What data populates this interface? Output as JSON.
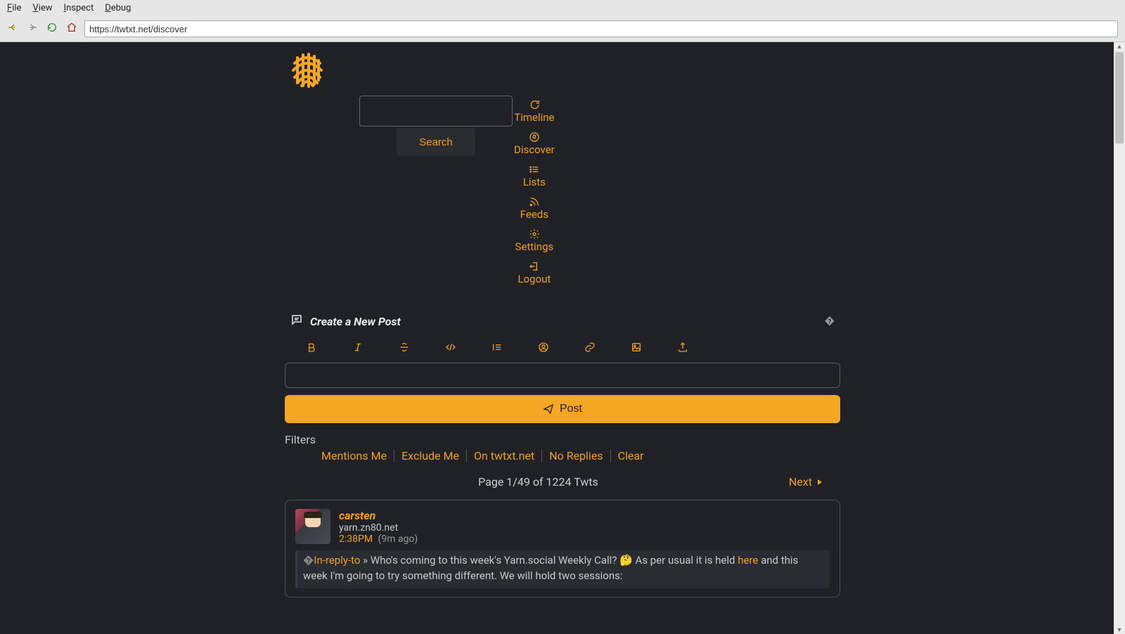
{
  "browser": {
    "menus": {
      "file": "File",
      "view": "View",
      "inspect": "Inspect",
      "debug": "Debug"
    },
    "url": "https://twtxt.net/discover"
  },
  "nav": {
    "search_label": "Search",
    "items": [
      {
        "label": "Timeline"
      },
      {
        "label": "Discover"
      },
      {
        "label": "Lists"
      },
      {
        "label": "Feeds"
      },
      {
        "label": "Settings"
      },
      {
        "label": "Logout"
      }
    ]
  },
  "compose": {
    "title": "Create a New Post",
    "post_label": "Post",
    "help": "�"
  },
  "filters": {
    "label": "Filters",
    "items": [
      "Mentions Me",
      "Exclude Me",
      "On twtxt.net",
      "No Replies",
      "Clear"
    ]
  },
  "pager": {
    "info": "Page 1/49 of 1224 Twts",
    "next": "Next"
  },
  "post": {
    "author": "carsten",
    "domain": "yarn.zn80.net",
    "time": "2:38PM",
    "ago": "(9m ago)",
    "glyph": "�",
    "reply_label": "In-reply-to",
    "sep": " » ",
    "text1": "Who's coming to this week's Yarn.social Weekly Call? 🤔 As per usual it is held ",
    "link": "here",
    "text2": " and this week I'm going to try something different. We will hold two sessions:"
  }
}
